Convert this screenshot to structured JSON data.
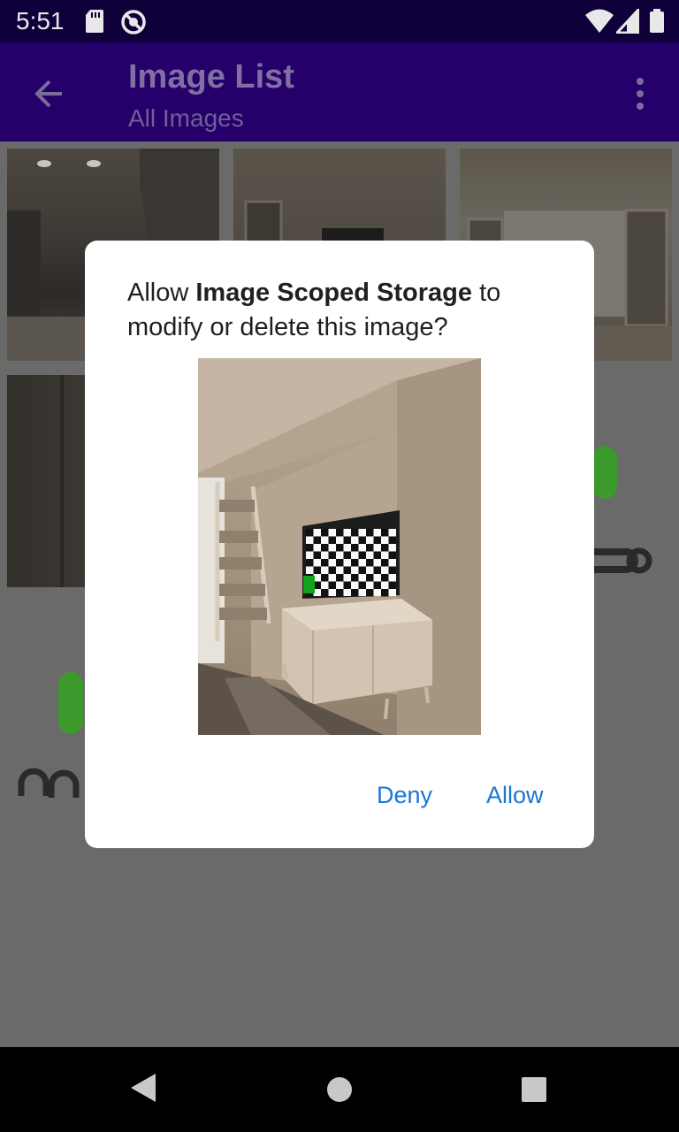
{
  "status_bar": {
    "time": "5:51",
    "icons": [
      "sd-card-icon",
      "sync-disabled-icon",
      "wifi-icon",
      "signal-icon",
      "battery-icon"
    ]
  },
  "app_bar": {
    "title": "Image List",
    "subtitle": "All Images",
    "icons": [
      "arrow-back-icon",
      "more-vert-icon"
    ]
  },
  "dialog": {
    "title_prefix": "Allow ",
    "app_name": "Image Scoped Storage",
    "title_suffix": " to modify or delete this image?",
    "deny_label": "Deny",
    "allow_label": "Allow",
    "button_color": "#1976d2"
  },
  "nav_bar": {
    "icons": [
      "back-triangle-icon",
      "home-circle-icon",
      "recents-square-icon"
    ]
  },
  "colors": {
    "status_bar": "#10003a",
    "app_bar": "#25006a",
    "scrim_bg": "#6a6a6a",
    "android_green": "#3c9a2d"
  }
}
